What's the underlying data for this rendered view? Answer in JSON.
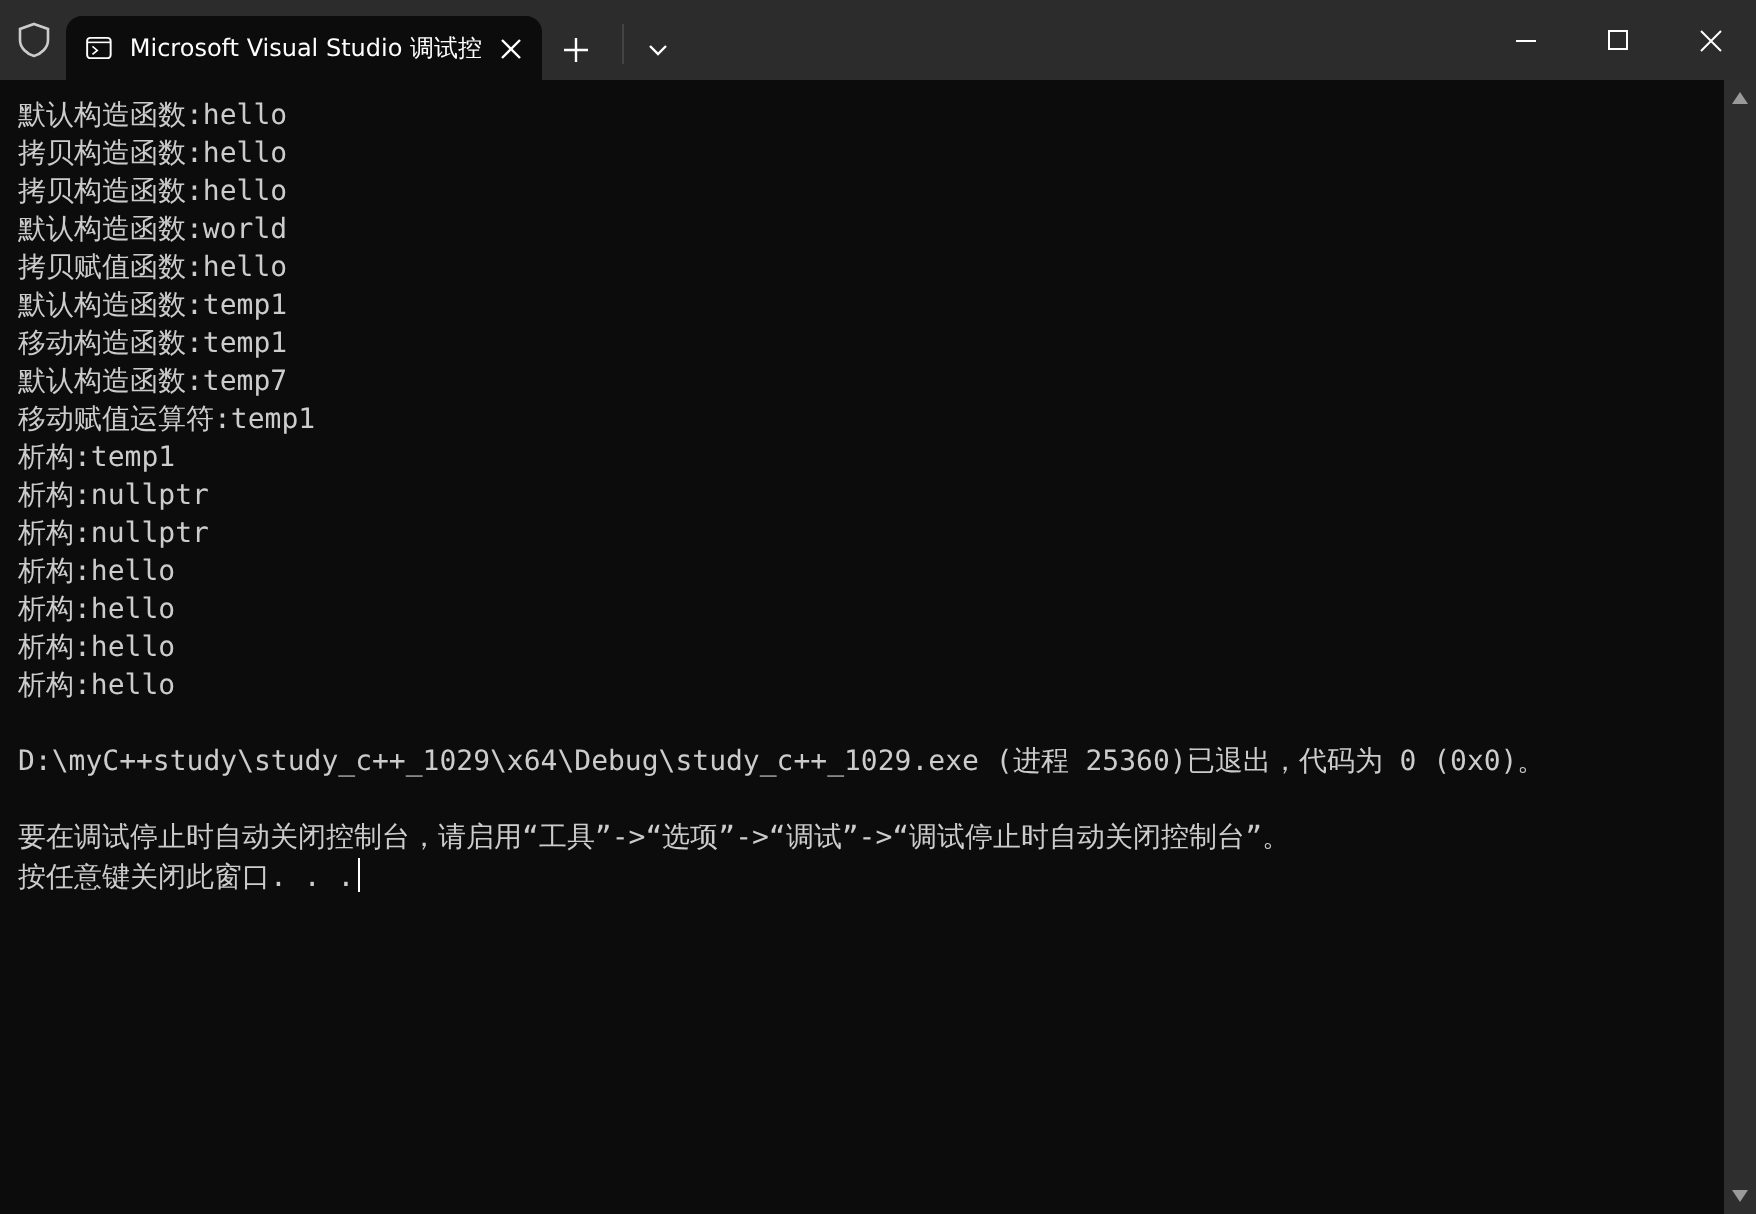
{
  "tab": {
    "title": "Microsoft Visual Studio 调试控",
    "selected": true
  },
  "output_lines": [
    "默认构造函数:hello",
    "拷贝构造函数:hello",
    "拷贝构造函数:hello",
    "默认构造函数:world",
    "拷贝赋值函数:hello",
    "默认构造函数:temp1",
    "移动构造函数:temp1",
    "默认构造函数:temp7",
    "移动赋值运算符:temp1",
    "析构:temp1",
    "析构:nullptr",
    "析构:nullptr",
    "析构:hello",
    "析构:hello",
    "析构:hello",
    "析构:hello"
  ],
  "exit_message": "D:\\myC++study\\study_c++_1029\\x64\\Debug\\study_c++_1029.exe (进程 25360)已退出，代码为 0 (0x0)。",
  "hint_lines": [
    "要在调试停止时自动关闭控制台，请启用“工具”->“选项”->“调试”->“调试停止时自动关闭控制台”。",
    "按任意键关闭此窗口. . ."
  ]
}
